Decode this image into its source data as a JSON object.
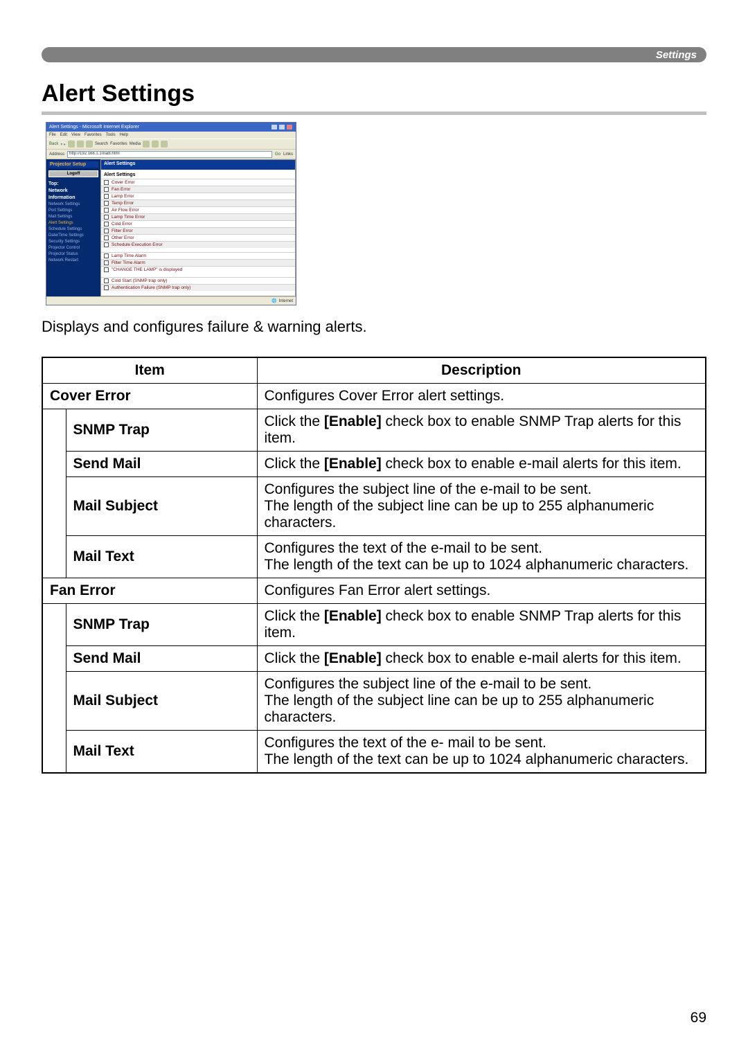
{
  "header_tab": "Settings",
  "page_title": "Alert Settings",
  "intro": "Displays and configures failure & warning alerts.",
  "page_number": "69",
  "screenshot": {
    "window_title": "Alert Settings - Microsoft Internet Explorer",
    "menus": [
      "File",
      "Edit",
      "View",
      "Favorites",
      "Tools",
      "Help"
    ],
    "toolbar": [
      "Back",
      "Search",
      "Favorites",
      "Media"
    ],
    "address_label": "Address",
    "address": "http://192.168.1.10/adl.html",
    "go": "Go",
    "links": "Links",
    "sidebar": {
      "heading": "Projector Setup",
      "logoff": "Logoff",
      "groups": [
        "Top:",
        "Network",
        "Information"
      ],
      "items": [
        "Network Settings",
        "Port Settings",
        "Mail Settings",
        "Alert Settings",
        "Schedule Settings",
        "Date/Time Settings",
        "Security Settings",
        "Projector Control",
        "Projector Status",
        "Network Restart"
      ],
      "active_index": 3
    },
    "content": {
      "header": "Alert Settings",
      "section1_label": "Alert Settings",
      "errors": [
        "Cover Error",
        "Fan Error",
        "Lamp Error",
        "Temp Error",
        "Air Flow Error",
        "Lamp Time Error",
        "Cold Error",
        "Filter Error",
        "Other Error",
        "Schedule Execution Error"
      ],
      "alarms": [
        "Lamp Time Alarm",
        "Filter Time Alarm",
        "\"CHANGE THE LAMP\" is displayed"
      ],
      "snmp": [
        "Cold Start (SNMP trap only)",
        "Authentication Failure (SNMP trap only)"
      ]
    },
    "status": "Internet"
  },
  "table": {
    "headers": {
      "item": "Item",
      "description": "Description"
    },
    "groups": [
      {
        "name": "Cover Error",
        "desc": "Configures Cover Error alert settings.",
        "subs": [
          {
            "name": "SNMP Trap",
            "desc_parts": [
              "Click the ",
              "[Enable]",
              " check box to enable SNMP Trap alerts for this item."
            ]
          },
          {
            "name": "Send Mail",
            "desc_parts": [
              "Click the ",
              "[Enable]",
              " check box to enable e-mail alerts for this item."
            ]
          },
          {
            "name": "Mail Subject",
            "desc": "Configures the subject line of the e-mail to be sent.\nThe length of the subject line can be up to 255 alphanumeric characters."
          },
          {
            "name": "Mail Text",
            "desc": "Configures the text of the e-mail to be sent.\nThe length of the text can be up to 1024 alphanumeric characters."
          }
        ]
      },
      {
        "name": "Fan Error",
        "desc": "Configures Fan Error alert settings.",
        "subs": [
          {
            "name": "SNMP Trap",
            "desc_parts": [
              "Click the ",
              "[Enable]",
              " check box to enable SNMP Trap alerts for this item."
            ]
          },
          {
            "name": "Send Mail",
            "desc_parts": [
              "Click the ",
              "[Enable]",
              " check box to enable e-mail alerts for this item."
            ]
          },
          {
            "name": "Mail Subject",
            "desc": "Configures the subject line of the e-mail to be sent.\nThe length of the subject line can be up to 255 alphanumeric characters."
          },
          {
            "name": "Mail Text",
            "desc": "Configures the text of the e- mail to be sent.\nThe length of the text can be up to 1024 alphanumeric characters."
          }
        ]
      }
    ]
  }
}
